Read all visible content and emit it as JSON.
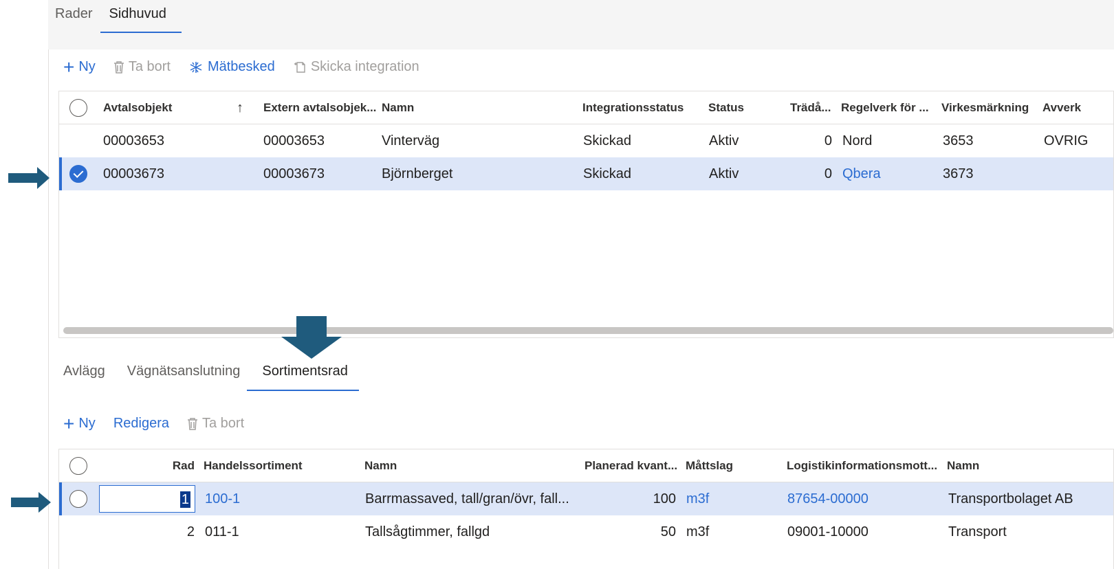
{
  "top_tabs": [
    {
      "label": "Rader",
      "active": false
    },
    {
      "label": "Sidhuvud",
      "active": true
    }
  ],
  "toolbar": {
    "new_label": "Ny",
    "delete_label": "Ta bort",
    "measure_label": "Mätbesked",
    "integration_label": "Skicka integration"
  },
  "grid1": {
    "headers": {
      "avtalsobjekt": "Avtalsobjekt",
      "extern": "Extern avtalsobjek...",
      "namn": "Namn",
      "integrationsstatus": "Integrationsstatus",
      "status": "Status",
      "trada": "Trädå...",
      "regelverk": "Regelverk för ...",
      "virkes": "Virkesmärkning",
      "avverk": "Avverk"
    },
    "rows": [
      {
        "avtalsobjekt": "00003653",
        "extern": "00003653",
        "namn": "Vinterväg",
        "integrationsstatus": "Skickad",
        "status": "Aktiv",
        "trada": "0",
        "regelverk": "Nord",
        "virkes": "3653",
        "avverk": "OVRIG",
        "selected": false
      },
      {
        "avtalsobjekt": "00003673",
        "extern": "00003673",
        "namn": "Björnberget",
        "integrationsstatus": "Skickad",
        "status": "Aktiv",
        "trada": "0",
        "regelverk": "Qbera",
        "virkes": "3673",
        "avverk": "",
        "selected": true
      }
    ]
  },
  "sub_tabs": [
    {
      "label": "Avlägg",
      "active": false
    },
    {
      "label": "Vägnätsanslutning",
      "active": false
    },
    {
      "label": "Sortimentsrad",
      "active": true
    }
  ],
  "toolbar2": {
    "new_label": "Ny",
    "edit_label": "Redigera",
    "delete_label": "Ta bort"
  },
  "grid2": {
    "headers": {
      "rad": "Rad",
      "handels": "Handelssortiment",
      "namn": "Namn",
      "planerad": "Planerad kvant...",
      "mattslag": "Måttslag",
      "logistik": "Logistikinformationsmott...",
      "namn2": "Namn"
    },
    "rows": [
      {
        "rad": "1",
        "handels": "100-1",
        "namn": "Barrmassaved, tall/gran/övr, fall...",
        "planerad": "100",
        "mattslag": "m3f",
        "logistik": "87654-00000",
        "namn2": "Transportbolaget AB",
        "selected": true
      },
      {
        "rad": "2",
        "handels": "011-1",
        "namn": "Tallsågtimmer, fallgd",
        "planerad": "50",
        "mattslag": "m3f",
        "logistik": "09001-10000",
        "namn2": "Transport",
        "selected": false
      }
    ]
  },
  "colors": {
    "accent": "#2b6cd1",
    "selected_row": "#dde6f8",
    "arrow": "#1f5b7d"
  },
  "icons": {
    "plus": "plus-icon",
    "trash": "trash-icon",
    "measure": "measure-icon",
    "send": "send-document-icon",
    "sort": "sort-ascending-icon"
  }
}
